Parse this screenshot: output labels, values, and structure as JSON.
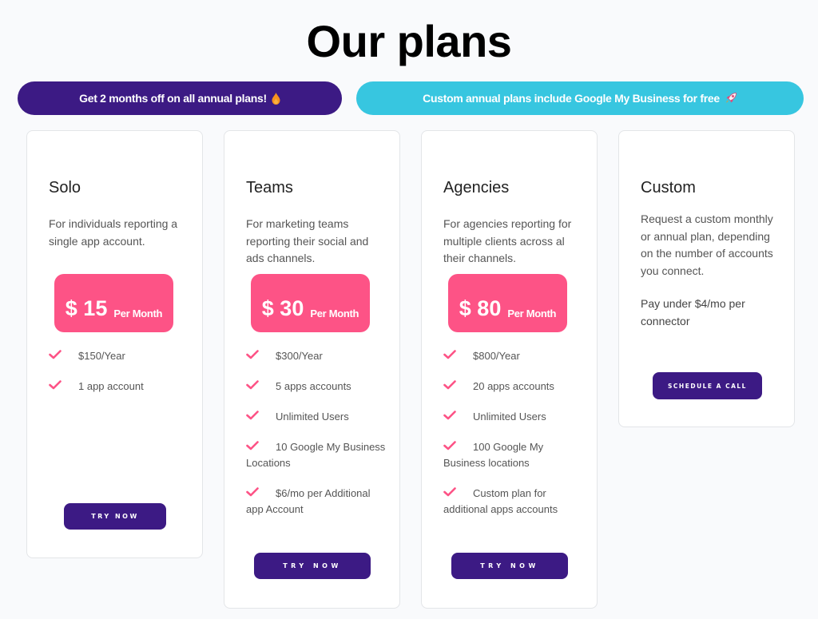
{
  "header": {
    "title": "Our plans"
  },
  "banners": {
    "annual": {
      "text": "Get 2 months off on all annual plans!",
      "icon": "fire-icon",
      "color": "#3c1a84"
    },
    "custom": {
      "text": "Custom annual plans include Google My Business for free",
      "icon": "rocket-icon",
      "color": "#37c6e0"
    }
  },
  "colors": {
    "primary": "#3c1a84",
    "accent_pink": "#fd5386",
    "accent_cyan": "#37c6e0",
    "check": "#fd5386"
  },
  "plans": [
    {
      "name": "Solo",
      "description": "For individuals reporting a single app account.",
      "price": "$ 15",
      "period": "Per Month",
      "features": [
        "$150/Year",
        "1 app account"
      ],
      "cta": "TRY NOW"
    },
    {
      "name": "Teams",
      "description": "For marketing teams reporting their social and ads channels.",
      "price": "$ 30",
      "period": "Per Month",
      "features": [
        "$300/Year",
        "5 apps accounts",
        "Unlimited Users",
        "10 Google My Business Locations",
        "$6/mo per Additional app Account"
      ],
      "cta": "TRY NOW"
    },
    {
      "name": "Agencies",
      "description": "For agencies reporting for multiple clients across al their channels.",
      "price": "$ 80",
      "period": "Per Month",
      "features": [
        "$800/Year",
        "20 apps accounts",
        "Unlimited Users",
        "100 Google My Business locations",
        "Custom plan for additional apps accounts"
      ],
      "cta": "TRY NOW"
    },
    {
      "name": "Custom",
      "description": "Request a custom monthly or annual plan, depending on the number of accounts you connect.",
      "note": "Pay under $4/mo per connector",
      "cta": "SCHEDULE A CALL"
    }
  ]
}
